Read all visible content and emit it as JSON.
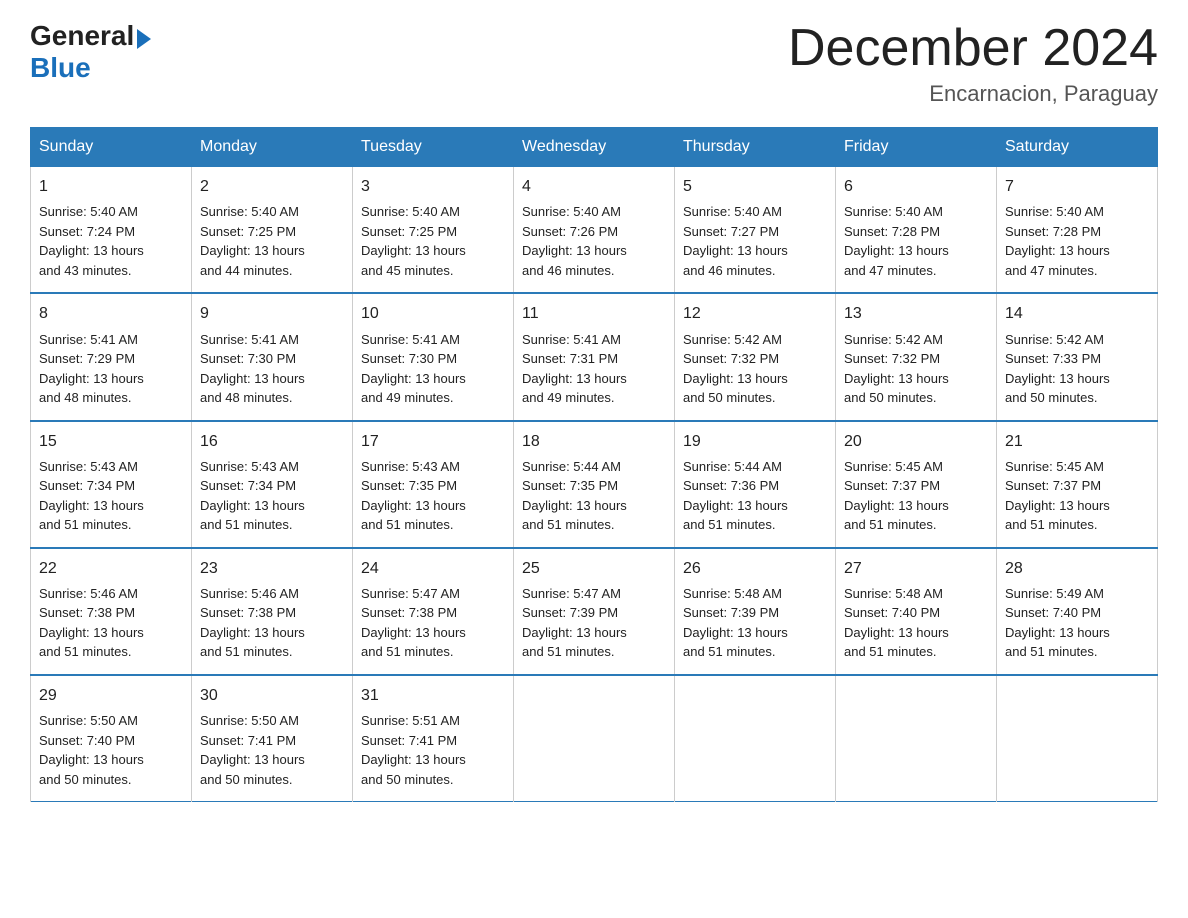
{
  "header": {
    "logo_general": "General",
    "logo_blue": "Blue",
    "month_title": "December 2024",
    "location": "Encarnacion, Paraguay"
  },
  "days_of_week": [
    "Sunday",
    "Monday",
    "Tuesday",
    "Wednesday",
    "Thursday",
    "Friday",
    "Saturday"
  ],
  "weeks": [
    [
      {
        "day": "1",
        "sunrise": "5:40 AM",
        "sunset": "7:24 PM",
        "daylight": "13 hours and 43 minutes."
      },
      {
        "day": "2",
        "sunrise": "5:40 AM",
        "sunset": "7:25 PM",
        "daylight": "13 hours and 44 minutes."
      },
      {
        "day": "3",
        "sunrise": "5:40 AM",
        "sunset": "7:25 PM",
        "daylight": "13 hours and 45 minutes."
      },
      {
        "day": "4",
        "sunrise": "5:40 AM",
        "sunset": "7:26 PM",
        "daylight": "13 hours and 46 minutes."
      },
      {
        "day": "5",
        "sunrise": "5:40 AM",
        "sunset": "7:27 PM",
        "daylight": "13 hours and 46 minutes."
      },
      {
        "day": "6",
        "sunrise": "5:40 AM",
        "sunset": "7:28 PM",
        "daylight": "13 hours and 47 minutes."
      },
      {
        "day": "7",
        "sunrise": "5:40 AM",
        "sunset": "7:28 PM",
        "daylight": "13 hours and 47 minutes."
      }
    ],
    [
      {
        "day": "8",
        "sunrise": "5:41 AM",
        "sunset": "7:29 PM",
        "daylight": "13 hours and 48 minutes."
      },
      {
        "day": "9",
        "sunrise": "5:41 AM",
        "sunset": "7:30 PM",
        "daylight": "13 hours and 48 minutes."
      },
      {
        "day": "10",
        "sunrise": "5:41 AM",
        "sunset": "7:30 PM",
        "daylight": "13 hours and 49 minutes."
      },
      {
        "day": "11",
        "sunrise": "5:41 AM",
        "sunset": "7:31 PM",
        "daylight": "13 hours and 49 minutes."
      },
      {
        "day": "12",
        "sunrise": "5:42 AM",
        "sunset": "7:32 PM",
        "daylight": "13 hours and 50 minutes."
      },
      {
        "day": "13",
        "sunrise": "5:42 AM",
        "sunset": "7:32 PM",
        "daylight": "13 hours and 50 minutes."
      },
      {
        "day": "14",
        "sunrise": "5:42 AM",
        "sunset": "7:33 PM",
        "daylight": "13 hours and 50 minutes."
      }
    ],
    [
      {
        "day": "15",
        "sunrise": "5:43 AM",
        "sunset": "7:34 PM",
        "daylight": "13 hours and 51 minutes."
      },
      {
        "day": "16",
        "sunrise": "5:43 AM",
        "sunset": "7:34 PM",
        "daylight": "13 hours and 51 minutes."
      },
      {
        "day": "17",
        "sunrise": "5:43 AM",
        "sunset": "7:35 PM",
        "daylight": "13 hours and 51 minutes."
      },
      {
        "day": "18",
        "sunrise": "5:44 AM",
        "sunset": "7:35 PM",
        "daylight": "13 hours and 51 minutes."
      },
      {
        "day": "19",
        "sunrise": "5:44 AM",
        "sunset": "7:36 PM",
        "daylight": "13 hours and 51 minutes."
      },
      {
        "day": "20",
        "sunrise": "5:45 AM",
        "sunset": "7:37 PM",
        "daylight": "13 hours and 51 minutes."
      },
      {
        "day": "21",
        "sunrise": "5:45 AM",
        "sunset": "7:37 PM",
        "daylight": "13 hours and 51 minutes."
      }
    ],
    [
      {
        "day": "22",
        "sunrise": "5:46 AM",
        "sunset": "7:38 PM",
        "daylight": "13 hours and 51 minutes."
      },
      {
        "day": "23",
        "sunrise": "5:46 AM",
        "sunset": "7:38 PM",
        "daylight": "13 hours and 51 minutes."
      },
      {
        "day": "24",
        "sunrise": "5:47 AM",
        "sunset": "7:38 PM",
        "daylight": "13 hours and 51 minutes."
      },
      {
        "day": "25",
        "sunrise": "5:47 AM",
        "sunset": "7:39 PM",
        "daylight": "13 hours and 51 minutes."
      },
      {
        "day": "26",
        "sunrise": "5:48 AM",
        "sunset": "7:39 PM",
        "daylight": "13 hours and 51 minutes."
      },
      {
        "day": "27",
        "sunrise": "5:48 AM",
        "sunset": "7:40 PM",
        "daylight": "13 hours and 51 minutes."
      },
      {
        "day": "28",
        "sunrise": "5:49 AM",
        "sunset": "7:40 PM",
        "daylight": "13 hours and 51 minutes."
      }
    ],
    [
      {
        "day": "29",
        "sunrise": "5:50 AM",
        "sunset": "7:40 PM",
        "daylight": "13 hours and 50 minutes."
      },
      {
        "day": "30",
        "sunrise": "5:50 AM",
        "sunset": "7:41 PM",
        "daylight": "13 hours and 50 minutes."
      },
      {
        "day": "31",
        "sunrise": "5:51 AM",
        "sunset": "7:41 PM",
        "daylight": "13 hours and 50 minutes."
      },
      null,
      null,
      null,
      null
    ]
  ],
  "labels": {
    "sunrise": "Sunrise:",
    "sunset": "Sunset:",
    "daylight": "Daylight:"
  }
}
